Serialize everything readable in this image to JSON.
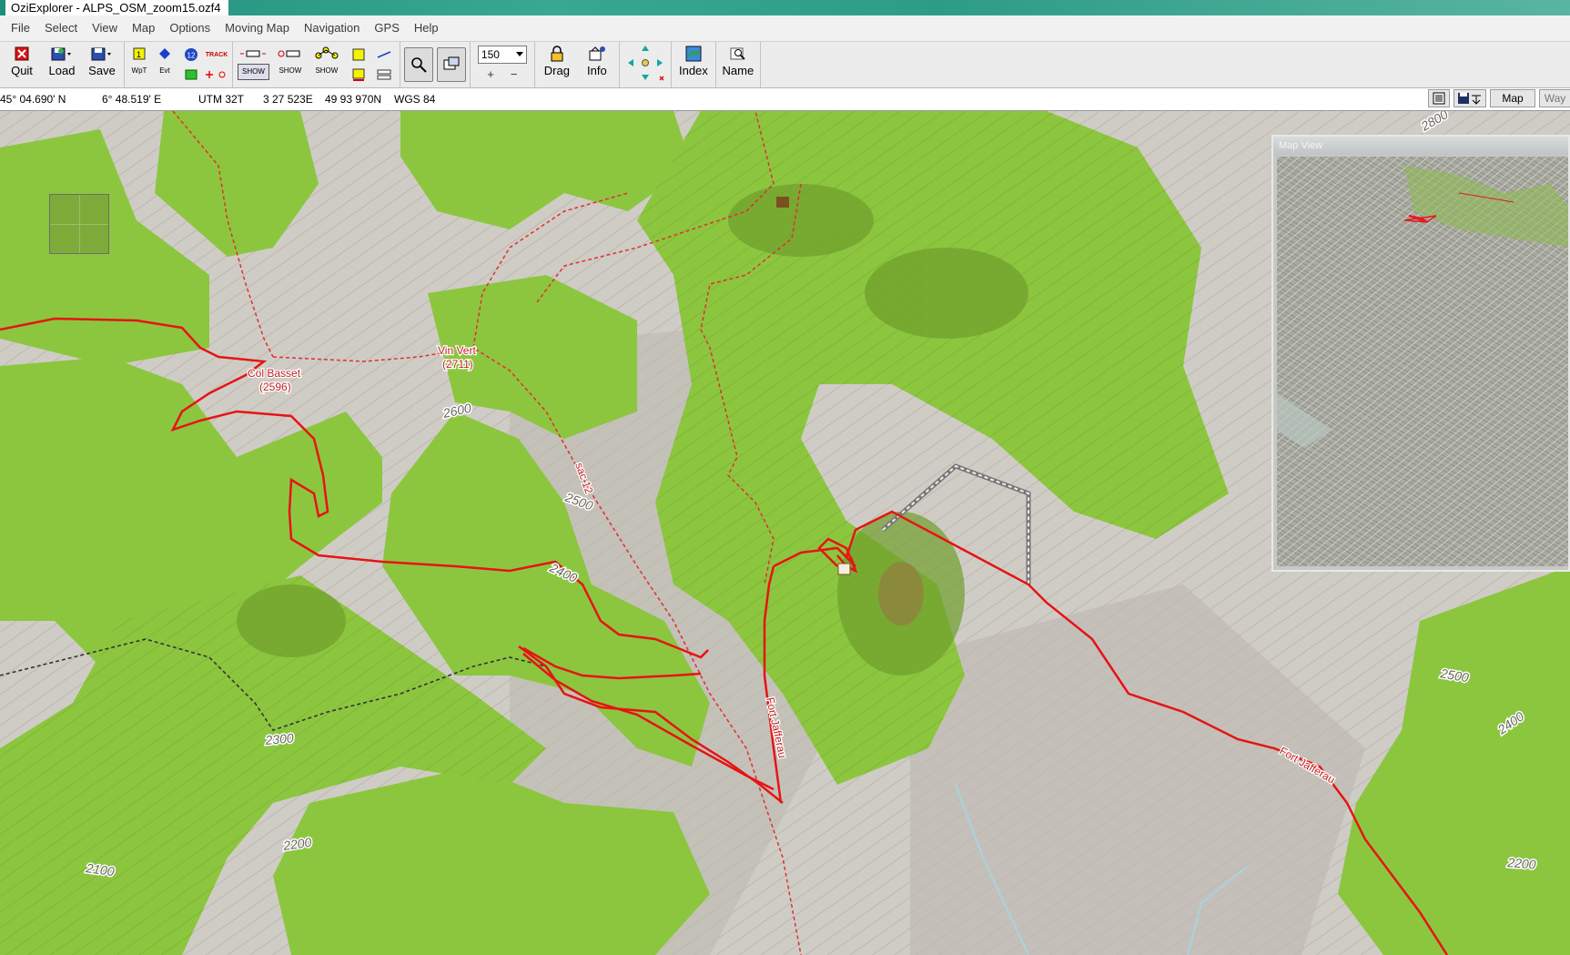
{
  "window": {
    "title": "OziExplorer - ALPS_OSM_zoom15.ozf4"
  },
  "menu": [
    "File",
    "Select",
    "View",
    "Map",
    "Options",
    "Moving Map",
    "Navigation",
    "GPS",
    "Help"
  ],
  "toolbar": {
    "quit": "Quit",
    "load": "Load",
    "save": "Save",
    "wpt": "WpT",
    "evt": "Evt",
    "track": "TRACK",
    "show": "SHOW",
    "zoom_value": "150",
    "drag": "Drag",
    "info": "Info",
    "index": "Index",
    "name": "Name"
  },
  "status": {
    "lat": "45° 04.690' N",
    "lon": "6° 48.519' E",
    "utm": "UTM  32T",
    "easting": "3 27 523E",
    "northing": "49 93 970N",
    "datum": "WGS 84",
    "map_button": "Map",
    "way_button": "Way"
  },
  "map_view": {
    "title": "Map View"
  },
  "map_labels": {
    "col_basset": "Col Basset",
    "col_basset_elev": "(2596)",
    "vin_vert": "Vin Vert",
    "vin_vert_elev": "(2711)",
    "sac": "sac 12",
    "fort_jafferau_1": "Fort Jafferau",
    "fort_jafferau_2": "Fort Jafferau",
    "contours": [
      "2800",
      "2600",
      "2500",
      "2400",
      "2300",
      "2200",
      "2100",
      "2500",
      "2400",
      "2200"
    ]
  }
}
